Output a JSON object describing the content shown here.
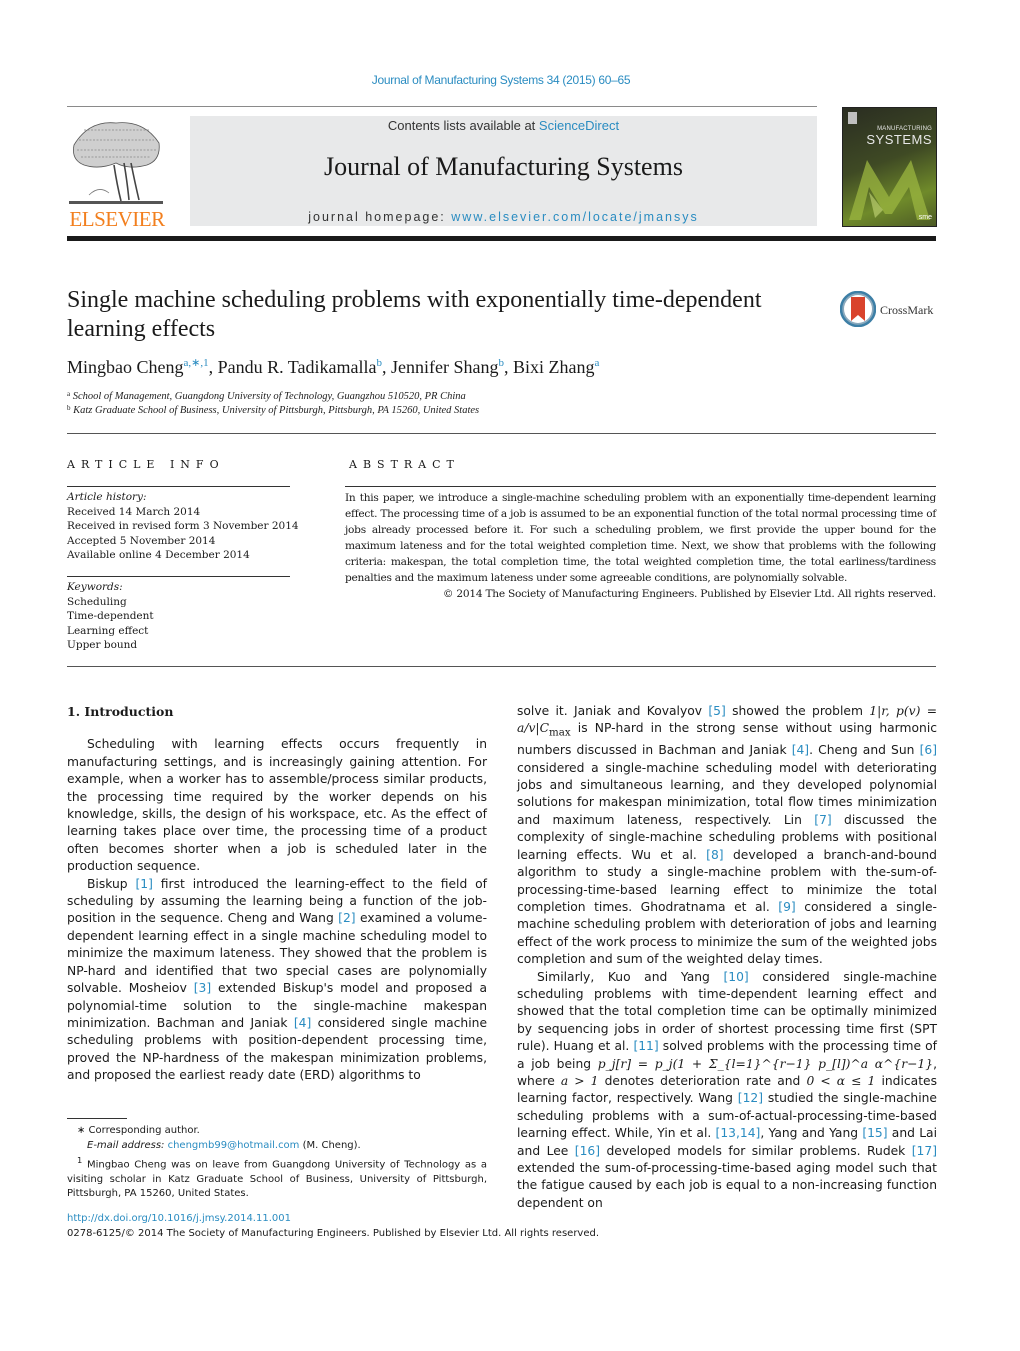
{
  "header": {
    "journal_ref": "Journal of Manufacturing Systems 34 (2015) 60–65",
    "publisher_logo_text": "ELSEVIER",
    "contents_prefix": "Contents lists available at ",
    "contents_link": "ScienceDirect",
    "journal_title": "Journal of Manufacturing Systems",
    "homepage_prefix": "journal homepage: ",
    "homepage_link": "www.elsevier.com/locate/jmansys",
    "cover": {
      "title_small": "MANUFACTURING",
      "title_big": "SYSTEMS",
      "badge": "sme"
    },
    "colors": {
      "link": "#2a8cc1",
      "elsevier_orange": "#f27f1e",
      "masthead_bg": "#e8e9ea"
    }
  },
  "article": {
    "title": "Single machine scheduling problems with exponentially time-dependent learning effects",
    "crossmark_label": "CrossMark",
    "authors": [
      {
        "name": "Mingbao Cheng",
        "sup": "a,∗,1",
        "sep": ", "
      },
      {
        "name": "Pandu R. Tadikamalla",
        "sup": "b",
        "sep": ", "
      },
      {
        "name": "Jennifer Shang",
        "sup": "b",
        "sep": ", "
      },
      {
        "name": "Bixi Zhang",
        "sup": "a",
        "sep": ""
      }
    ],
    "affiliations": [
      {
        "key": "a",
        "text": "School of Management, Guangdong University of Technology, Guangzhou 510520, PR China"
      },
      {
        "key": "b",
        "text": "Katz Graduate School of Business, University of Pittsburgh, Pittsburgh, PA 15260, United States"
      }
    ]
  },
  "article_info": {
    "heading": "ARTICLE INFO",
    "history_label": "Article history:",
    "history": [
      "Received 14 March 2014",
      "Received in revised form 3 November 2014",
      "Accepted 5 November 2014",
      "Available online 4 December 2014"
    ],
    "keywords_label": "Keywords:",
    "keywords": [
      "Scheduling",
      "Time-dependent",
      "Learning effect",
      "Upper bound"
    ]
  },
  "abstract": {
    "heading": "ABSTRACT",
    "text": "In this paper, we introduce a single-machine scheduling problem with an exponentially time-dependent learning effect. The processing time of a job is assumed to be an exponential function of the total normal processing time of jobs already processed before it. For such a scheduling problem, we first provide the upper bound for the maximum lateness and for the total weighted completion time. Next, we show that problems with the following criteria: makespan, the total completion time, the total weighted completion time, the total earliness/tardiness penalties and the maximum lateness under some agreeable conditions, are polynomially solvable.",
    "copyright": "© 2014 The Society of Manufacturing Engineers. Published by Elsevier Ltd. All rights reserved."
  },
  "body": {
    "section_heading": "1.  Introduction",
    "left": {
      "p1": "Scheduling with learning effects occurs frequently in manufacturing settings, and is increasingly gaining attention. For example, when a worker has to assemble/process similar products, the processing time required by the worker depends on his knowledge, skills, the design of his workspace, etc. As the effect of learning takes place over time, the processing time of a product often becomes shorter when a job is scheduled later in the production sequence.",
      "p2": [
        {
          "t": "Biskup "
        },
        {
          "ref": "[1]"
        },
        {
          "t": " first introduced the learning-effect to the field of scheduling by assuming the learning being a function of the job-position in the sequence. Cheng and Wang "
        },
        {
          "ref": "[2]"
        },
        {
          "t": " examined a volume-dependent learning effect in a single machine scheduling model to minimize the maximum lateness. They showed that the problem is NP-hard and identified that two special cases are polynomially solvable. Mosheiov "
        },
        {
          "ref": "[3]"
        },
        {
          "t": " extended Biskup's model and proposed a polynomial-time solution to the single-machine makespan minimization. Bachman and Janiak "
        },
        {
          "ref": "[4]"
        },
        {
          "t": " considered single machine scheduling problems with position-dependent processing time, proved the NP-hardness of the makespan minimization problems, and proposed the earliest ready date (ERD) algorithms to"
        }
      ]
    },
    "right": {
      "p1_a": "solve it. Janiak and Kovalyov ",
      "p1_ref5": "[5]",
      "p1_b": " showed the problem ",
      "p1_math": "1|r, p(v) = a/v|C",
      "p1_math_sub": "max",
      "p1_c": " is NP-hard in the strong sense without using harmonic numbers discussed in Bachman and Janiak ",
      "p1_ref4": "[4]",
      "p1_d": ". Cheng and Sun ",
      "p1_ref6": "[6]",
      "p1_e": " considered a single-machine scheduling model with deteriorating jobs and simultaneous learning, and they developed polynomial solutions for makespan minimization, total flow times minimization and maximum lateness, respectively. Lin ",
      "p1_ref7": "[7]",
      "p1_f": " discussed the complexity of single-machine scheduling problems with positional learning effects. Wu et al. ",
      "p1_ref8": "[8]",
      "p1_g": " developed a branch-and-bound algorithm to study a single-machine problem with the-sum-of-processing-time-based learning effect to minimize the total completion times. Ghodratnama et al. ",
      "p1_ref9": "[9]",
      "p1_h": " considered a single-machine scheduling problem with deterioration of jobs and learning effect of the work process to minimize the sum of the weighted jobs completion and sum of the weighted delay times.",
      "p2_a": "Similarly, Kuo and Yang ",
      "p2_ref10": "[10]",
      "p2_b": " considered single-machine scheduling problems with time-dependent learning effect and showed that the total completion time can be optimally minimized by sequencing jobs in order of shortest processing time first (SPT rule). Huang et al. ",
      "p2_ref11": "[11]",
      "p2_c": " solved problems with the processing time of a job being ",
      "p2_formula": "p_j[r] = p_j(1 + Σ_{l=1}^{r−1} p_[l])^a α^{r−1}",
      "p2_d": ", where ",
      "p2_cond1": "a > 1",
      "p2_e": " denotes deterioration rate and ",
      "p2_cond2": "0 < α ≤ 1",
      "p2_f": " indicates learning factor, respectively. Wang ",
      "p2_ref12": "[12]",
      "p2_g": " studied the single-machine scheduling problems with a sum-of-actual-processing-time-based learning effect. While, Yin et al. ",
      "p2_ref1314": "[13,14]",
      "p2_h": ", Yang and Yang ",
      "p2_ref15": "[15]",
      "p2_i": " and Lai and Lee ",
      "p2_ref16": "[16]",
      "p2_j": " developed models for similar problems. Rudek ",
      "p2_ref17": "[17]",
      "p2_k": " extended the sum-of-processing-time-based aging model such that the fatigue caused by each job is equal to a non-increasing function dependent on"
    }
  },
  "footnotes": {
    "corresponding": "∗  Corresponding author.",
    "email_label": "E-mail address: ",
    "email": "chengmb99@hotmail.com",
    "email_suffix": " (M. Cheng).",
    "note1_mark": "1",
    "note1": " Mingbao Cheng was on leave from Guangdong University of Technology as a visiting scholar in Katz Graduate School of Business, University of Pittsburgh, Pittsburgh, PA 15260, United States."
  },
  "doi": {
    "link": "http://dx.doi.org/10.1016/j.jmsy.2014.11.001",
    "issn_line": "0278-6125/© 2014 The Society of Manufacturing Engineers. Published by Elsevier Ltd. All rights reserved."
  }
}
